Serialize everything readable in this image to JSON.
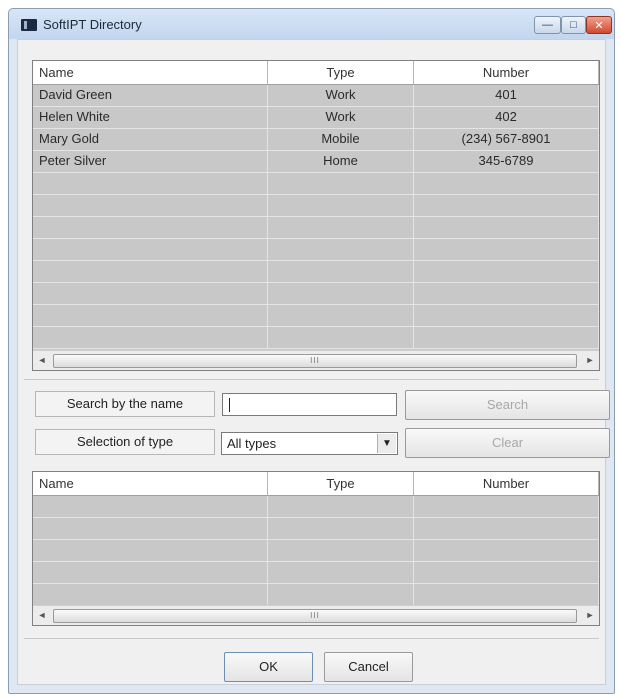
{
  "window": {
    "title": "SoftIPT Directory",
    "minimize_glyph": "—",
    "maximize_glyph": "□",
    "close_glyph": "✕"
  },
  "columns": {
    "name": "Name",
    "type": "Type",
    "number": "Number"
  },
  "contacts": [
    {
      "name": "David Green",
      "type": "Work",
      "number": "401"
    },
    {
      "name": "Helen White",
      "type": "Work",
      "number": "402"
    },
    {
      "name": "Mary Gold",
      "type": "Mobile",
      "number": "(234) 567-8901"
    },
    {
      "name": "Peter Silver",
      "type": "Home",
      "number": "345-6789"
    }
  ],
  "search": {
    "by_name_label": "Search by the name",
    "input_value": "",
    "button_label": "Search"
  },
  "type_filter": {
    "label": "Selection of type",
    "selected": "All types",
    "clear_label": "Clear"
  },
  "results": [],
  "scroll_grip": "III",
  "dialog": {
    "ok_label": "OK",
    "cancel_label": "Cancel"
  },
  "colors": {
    "list_bg": "#c8c8c8",
    "title_bar": "#c3d6ee",
    "close_button": "#cf4a2f"
  },
  "icons": {
    "app": "directory-app-icon",
    "dropdown": "chevron-down-icon",
    "scroll_left": "arrow-left-icon",
    "scroll_right": "arrow-right-icon"
  }
}
